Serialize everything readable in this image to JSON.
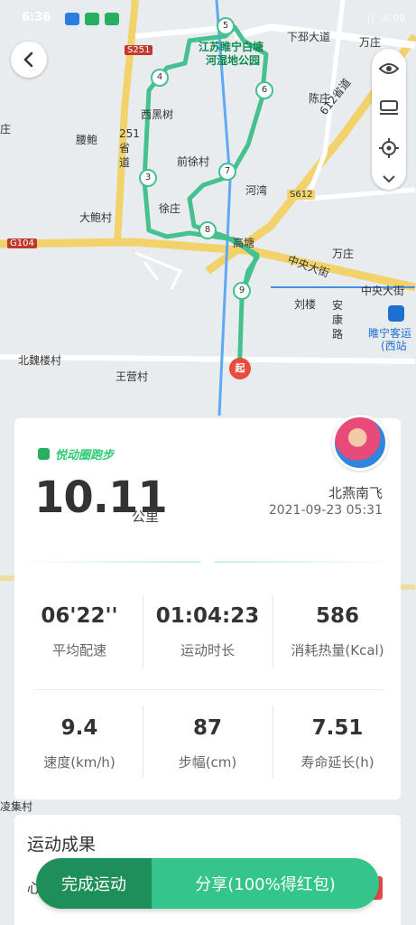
{
  "status_bar": {
    "time": "6:36",
    "right": "(( ·ıll 99"
  },
  "map": {
    "labels": [
      "江苏睢宁白塘",
      "河湿地公园",
      "下邳大道",
      "万庄",
      "S251",
      "西黑树",
      "腰鲍",
      "251省道",
      "前徐村",
      "徐庄",
      "河湾",
      "S612",
      "612省道",
      "大鲍村",
      "G104",
      "高塘",
      "万庄",
      "中央大街",
      "中央大街",
      "刘楼",
      "安康路",
      "睢宁客运",
      "(西站",
      "北魏楼村",
      "王营村",
      "陈庄",
      "庄",
      "凌集村"
    ],
    "markers": [
      "3",
      "4",
      "5",
      "6",
      "7",
      "8",
      "9"
    ],
    "start_marker": "起"
  },
  "header": {
    "back_icon": "back-arrow-icon"
  },
  "map_tools": {
    "icons": [
      "eye-icon",
      "km-icon",
      "locate-icon",
      "chevron-down-icon"
    ]
  },
  "summary": {
    "brand": "悦动圈跑步",
    "distance": "10.11",
    "unit": "公里",
    "user": "北燕南飞",
    "datetime": "2021-09-23 05:31"
  },
  "stats": [
    {
      "value": "06'22''",
      "label": "平均配速"
    },
    {
      "value": "01:04:23",
      "label": "运动时长"
    },
    {
      "value": "586",
      "label": "消耗热量(Kcal)"
    },
    {
      "value": "9.4",
      "label": "速度(km/h)"
    },
    {
      "value": "87",
      "label": "步幅(cm)"
    },
    {
      "value": "7.51",
      "label": "寿命延长(h)"
    }
  ],
  "results": {
    "title": "运动成果",
    "heart": "心"
  },
  "actions": {
    "finish": "完成运动",
    "share": "分享(100%得红包)"
  }
}
